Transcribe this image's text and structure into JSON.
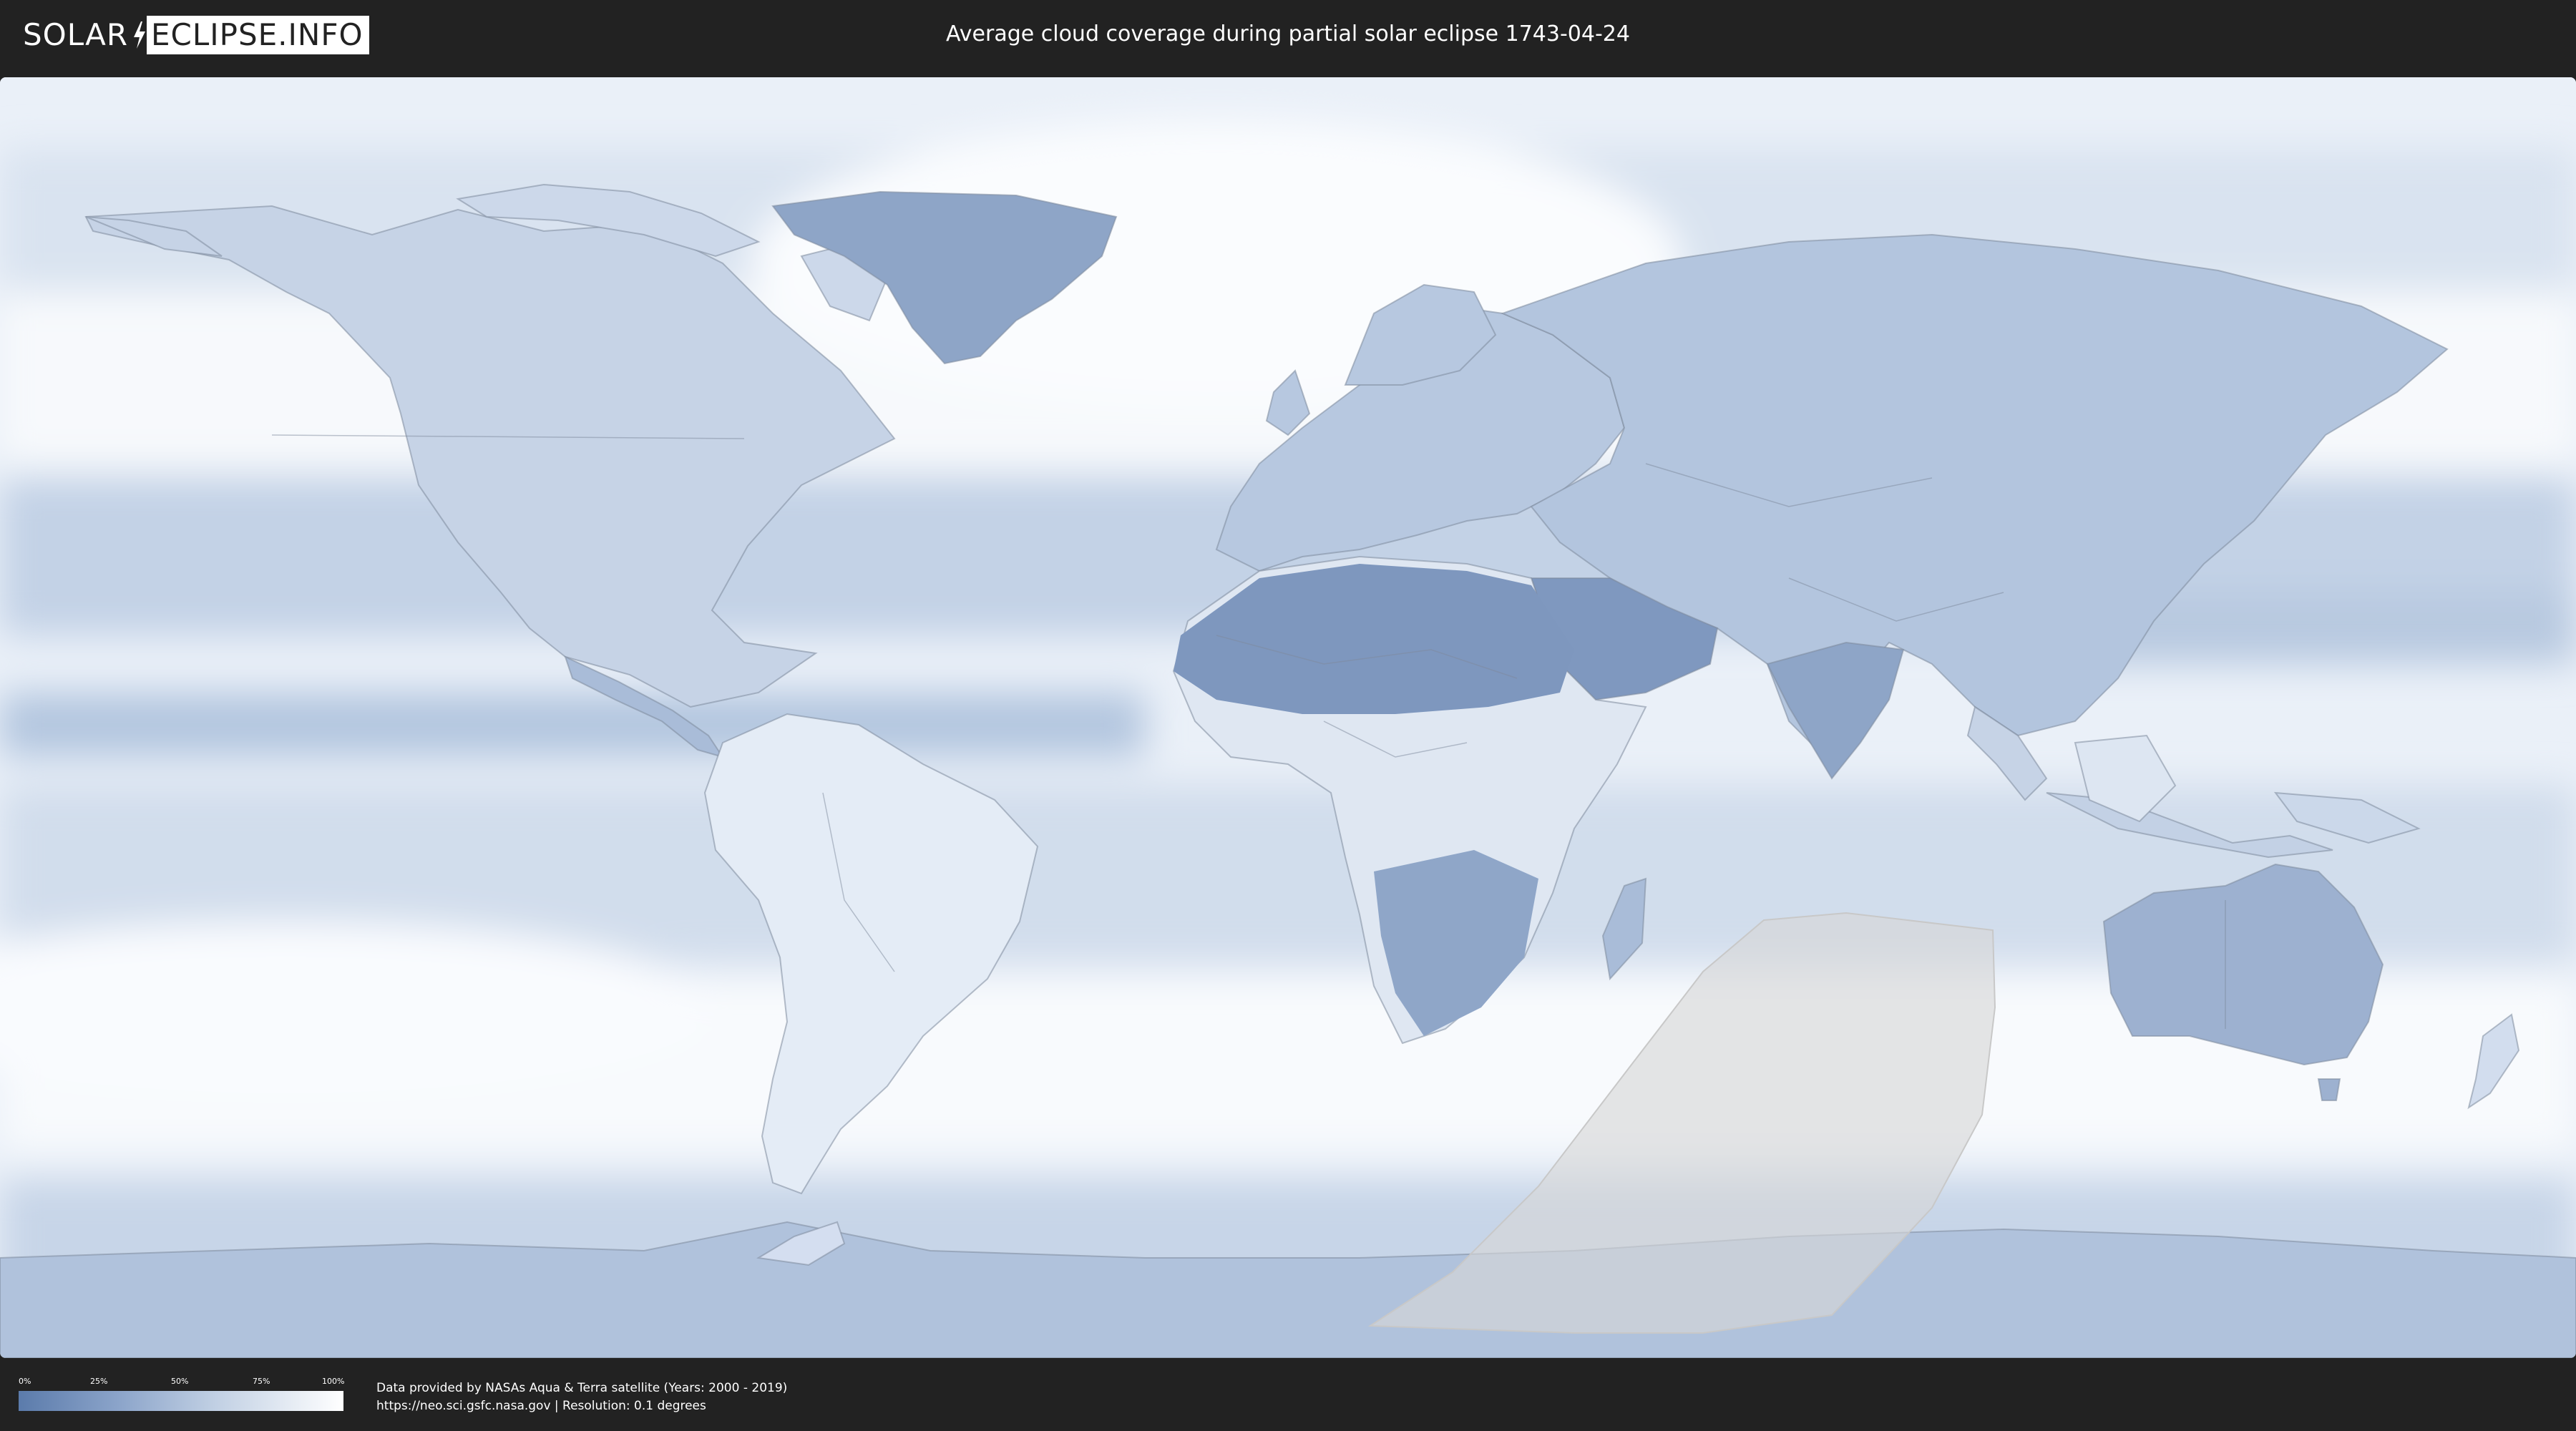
{
  "header": {
    "logo_left": "SOLAR",
    "logo_right": "ECLIPSE.INFO",
    "title": "Average cloud coverage during partial solar eclipse 1743-04-24"
  },
  "map": {
    "colors": {
      "ocean_clear": "#f6f9fd",
      "cloud_low": "#5b7bab",
      "cloud_mid": "#a9bcd8",
      "border": "#7d8a9c",
      "eclipse_zone": "#d6d6d6"
    }
  },
  "legend": {
    "ticks": [
      "0%",
      "25%",
      "50%",
      "75%",
      "100%"
    ],
    "gradient_start": "#5b7bab",
    "gradient_end": "#ffffff"
  },
  "footer": {
    "credit_line": "Data provided by NASAs Aqua & Terra satellite (Years: 2000 - 2019)",
    "source_line": "https://neo.sci.gsfc.nasa.gov | Resolution: 0.1 degrees"
  }
}
